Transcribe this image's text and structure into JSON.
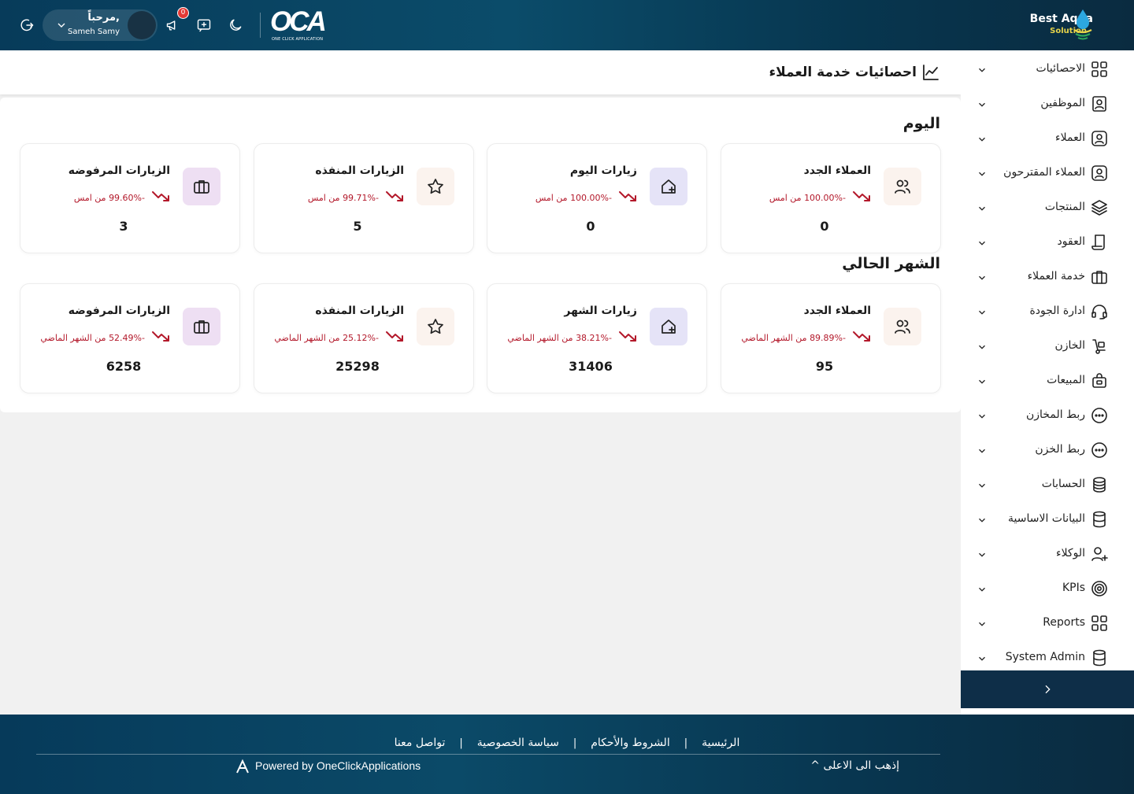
{
  "topbar": {
    "greeting": "مرحباً,",
    "user_name": "Sameh Samy",
    "notifications_count": "0",
    "logo_text": "OCA",
    "logo_subtitle": "ONE CLICK APPLICATION",
    "brand_name": "Best Aqua",
    "brand_sub": "Solution"
  },
  "sidebar": {
    "items": [
      {
        "label": "الاحصائيات",
        "icon": "grid-icon"
      },
      {
        "label": "الموظفين",
        "icon": "employee-icon"
      },
      {
        "label": "العملاء",
        "icon": "customer-icon"
      },
      {
        "label": "العملاء المقترحون",
        "icon": "prospect-icon"
      },
      {
        "label": "المنتجات",
        "icon": "layers-icon"
      },
      {
        "label": "العقود",
        "icon": "scroll-icon"
      },
      {
        "label": "خدمة العملاء",
        "icon": "briefcase-icon"
      },
      {
        "label": "ادارة الجودة",
        "icon": "headset-icon"
      },
      {
        "label": "الخازن",
        "icon": "dolly-icon"
      },
      {
        "label": "المبيعات",
        "icon": "bag-icon"
      },
      {
        "label": "ربط المخازن",
        "icon": "dots-circle-icon"
      },
      {
        "label": "ربط الخزن",
        "icon": "dots-circle-icon"
      },
      {
        "label": "الحسابات",
        "icon": "coins-icon"
      },
      {
        "label": "البيانات الاساسية",
        "icon": "database-icon"
      },
      {
        "label": "الوكلاء",
        "icon": "user-plus-icon"
      },
      {
        "label": "KPIs",
        "icon": "target-icon"
      },
      {
        "label": "Reports",
        "icon": "grid-icon"
      },
      {
        "label": "System Admin",
        "icon": "database-icon"
      }
    ]
  },
  "page": {
    "title": "احصائيات خدمة العملاء",
    "today_title": "اليوم",
    "month_title": "الشهر الحالي"
  },
  "today_cards": [
    {
      "title": "العملاء الجدد",
      "change": "-100.00% من امس",
      "value": "0",
      "icon": "users-icon",
      "tone": "peach"
    },
    {
      "title": "زيارات اليوم",
      "change": "-100.00% من امس",
      "value": "0",
      "icon": "home-plus-icon",
      "tone": "lilac"
    },
    {
      "title": "الزيارات المنفذه",
      "change": "-99.71% من امس",
      "value": "5",
      "icon": "star-icon",
      "tone": "peach"
    },
    {
      "title": "الزيارات المرفوضه",
      "change": "-99.60% من امس",
      "value": "3",
      "icon": "briefcase-icon",
      "tone": "pink"
    }
  ],
  "month_cards": [
    {
      "title": "العملاء الجدد",
      "change": "-89.89% من الشهر الماضي",
      "value": "95",
      "icon": "users-icon",
      "tone": "peach"
    },
    {
      "title": "زيارات الشهر",
      "change": "-38.21% من الشهر الماضي",
      "value": "31406",
      "icon": "home-plus-icon",
      "tone": "lilac"
    },
    {
      "title": "الزيارات المنفذه",
      "change": "-25.12% من الشهر الماضي",
      "value": "25298",
      "icon": "star-icon",
      "tone": "peach"
    },
    {
      "title": "الزيارات المرفوضه",
      "change": "-52.49% من الشهر الماضي",
      "value": "6258",
      "icon": "briefcase-icon",
      "tone": "pink"
    }
  ],
  "footer": {
    "links": [
      "الرئيسية",
      "الشروط والأحكام",
      "سياسة الخصوصية",
      "تواصل معنا"
    ],
    "powered_by": "Powered by OneClickApplications",
    "back_to_top": "إذهب الى الاعلى ^"
  },
  "colors": {
    "topbar": "#073b5a",
    "negative_change": "#b3182a",
    "collapse_button": "#0e2e48"
  }
}
